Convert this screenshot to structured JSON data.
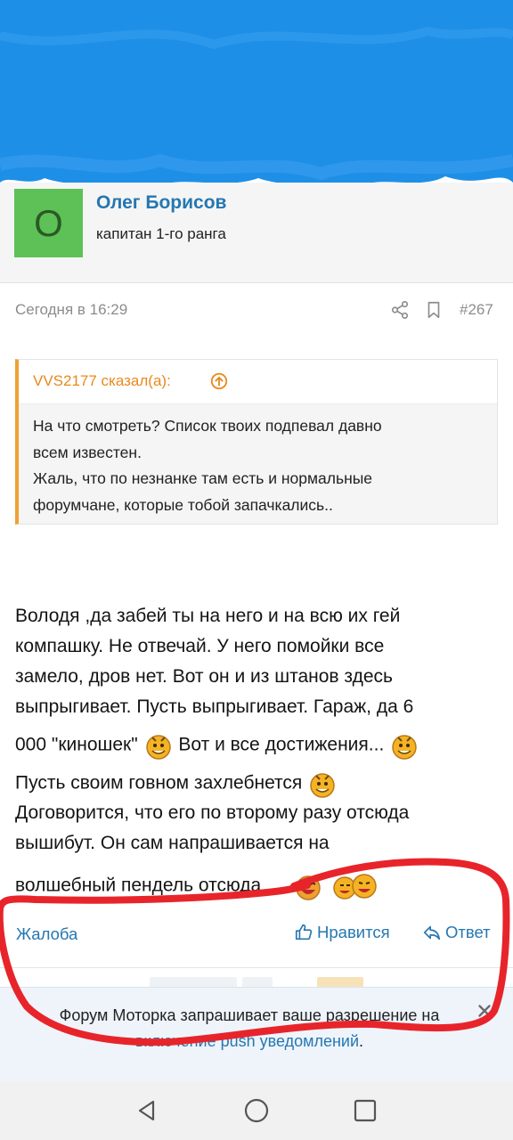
{
  "user": {
    "avatar_letter": "O",
    "avatar_color": "#5dc157",
    "name": "Олег Борисов",
    "title": "капитан 1-го ранга"
  },
  "post": {
    "date": "Сегодня в 16:29",
    "number": "#267",
    "quote": {
      "author": "VVS2177 сказал(а):",
      "lines": [
        "На что смотреть? Список твоих подпевал давно",
        "всем известен.",
        "Жаль, что по незнанке там есть и нормальные",
        "форумчане, которые тобой запачкались.."
      ]
    },
    "body_lines": [
      "Володя ,да забей ты на него и на всю их гей",
      "компашку. Не отвечай. У него помойки все",
      "замело, дров нет. Вот он и из штанов здесь",
      "выпрыгивает. Пусть выпрыгивает. Гараж, да 6",
      "000 \"киношек\"",
      "Вот и все достижения...",
      "Пусть своим говном захлебнется",
      "Договорится, что его по второму разу отсюда",
      "вышибут. Он сам напрашивается на",
      "волшебный пендель отсюда"
    ]
  },
  "actions": {
    "report": "Жалоба",
    "like": "Нравится",
    "reply": "Ответ"
  },
  "push_banner": {
    "text": "Форум Моторка запрашивает ваше разрешение на",
    "link": "включение push уведомлений",
    "suffix": "."
  },
  "colors": {
    "accent": "#2577b1",
    "quote_border": "#f0a034",
    "scribble_blue": "#1e8fe6",
    "annotation_red": "#e8242b"
  },
  "icons": [
    "share-icon",
    "bookmark-icon",
    "arrow-up-circle-icon",
    "thumbs-up-icon",
    "reply-icon",
    "close-icon",
    "back-icon",
    "home-icon",
    "recent-apps-icon"
  ]
}
